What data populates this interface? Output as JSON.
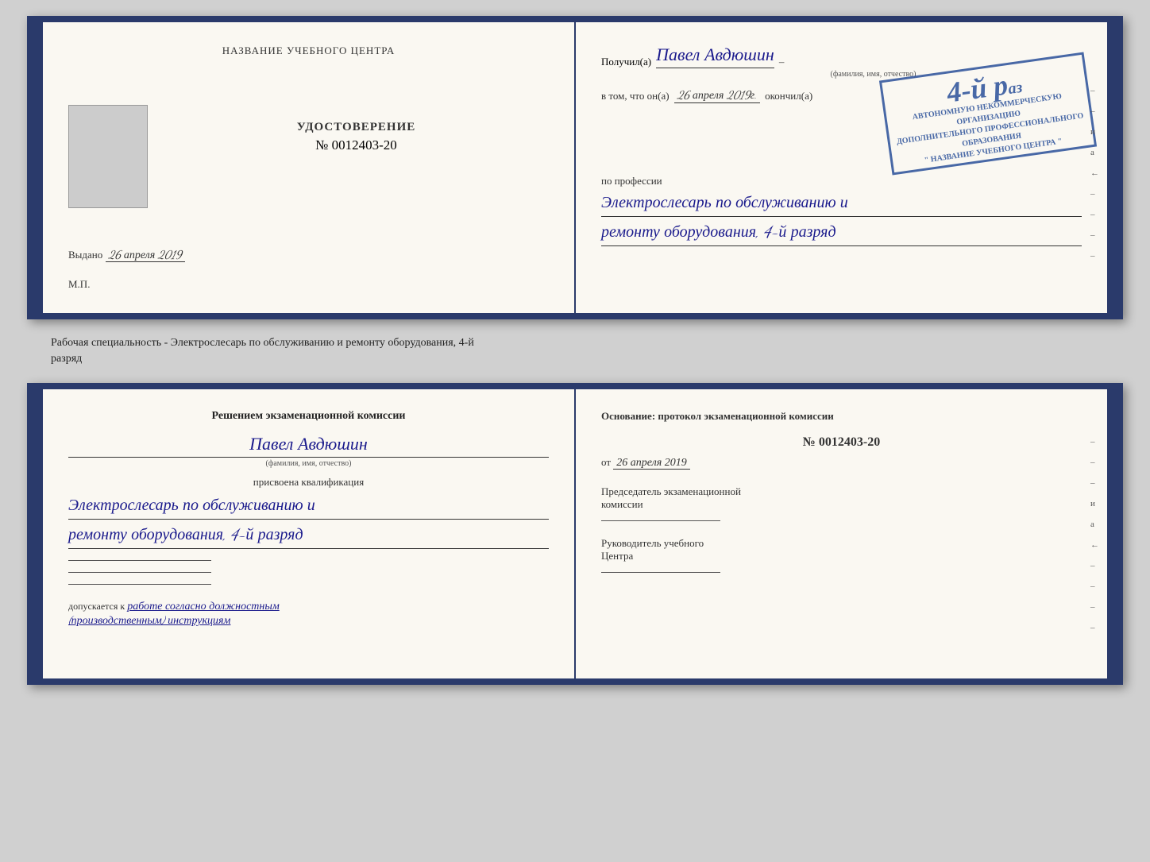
{
  "top_book": {
    "left_page": {
      "title": "НАЗВАНИЕ УЧЕБНОГО ЦЕНТРА",
      "photo_alt": "Фото",
      "doc_type": "УДОСТОВЕРЕНИЕ",
      "doc_number": "№ 0012403-20",
      "vydano_label": "Выдано",
      "vydano_date": "26 апреля 2019",
      "mp_label": "М.П."
    },
    "right_page": {
      "poluchil_label": "Получил(а)",
      "poluchil_name": "Павел Авдюшин",
      "fio_label": "(фамилия, имя, отчество)",
      "vtom_label": "в том, что он(а)",
      "vtom_date": "26 апреля 2019г.",
      "okonchil_label": "окончил(а)",
      "stamp_line1": "АВТОНОМНУЮ НЕКОММЕРЧЕСКУЮ ОРГАНИЗАЦИЮ",
      "stamp_line2": "ДОПОЛНИТЕЛЬНОГО ПРОФЕССИОНАЛЬНОГО ОБРАЗОВАНИЯ",
      "stamp_line3": "\" НАЗВАНИЕ УЧЕБНОГО ЦЕНТРА \"",
      "stamp_number": "4-й р...",
      "po_professii_label": "по профессии",
      "profession_line1": "Электрослесарь по обслуживанию и",
      "profession_line2": "ремонту оборудования, 4-й разряд",
      "deco_chars": [
        "–",
        "и",
        "а",
        "←",
        "–",
        "–",
        "–",
        "–",
        "–"
      ]
    }
  },
  "specialty_text": "Рабочая специальность - Электрослесарь по обслуживанию и ремонту оборудования, 4-й",
  "specialty_text2": "разряд",
  "bottom_book": {
    "left_page": {
      "resheniye_title": "Решением экзаменационной комиссии",
      "fio_name": "Павел Авдюшин",
      "fio_label": "(фамилия, имя, отчество)",
      "prisvoena_label": "присвоена квалификация",
      "qualification_line1": "Электрослесарь по обслуживанию и",
      "qualification_line2": "ремонту оборудования, 4-й разряд",
      "dopusk_prefix": "допускается к",
      "dopusk_text": "работе согласно должностным",
      "dopusk_text2": "(производственным) инструкциям"
    },
    "right_page": {
      "osnovaniye_label": "Основание: протокол экзаменационной комиссии",
      "number": "№ 0012403-20",
      "ot_prefix": "от",
      "ot_date": "26 апреля 2019",
      "predsedatel_label": "Председатель экзаменационной",
      "predsedatel_label2": "комиссии",
      "rukovoditel_label": "Руководитель учебного",
      "rukovoditel_label2": "Центра",
      "deco_chars": [
        "–",
        "–",
        "–",
        "и",
        "а",
        "←",
        "–",
        "–",
        "–",
        "–"
      ]
    }
  }
}
